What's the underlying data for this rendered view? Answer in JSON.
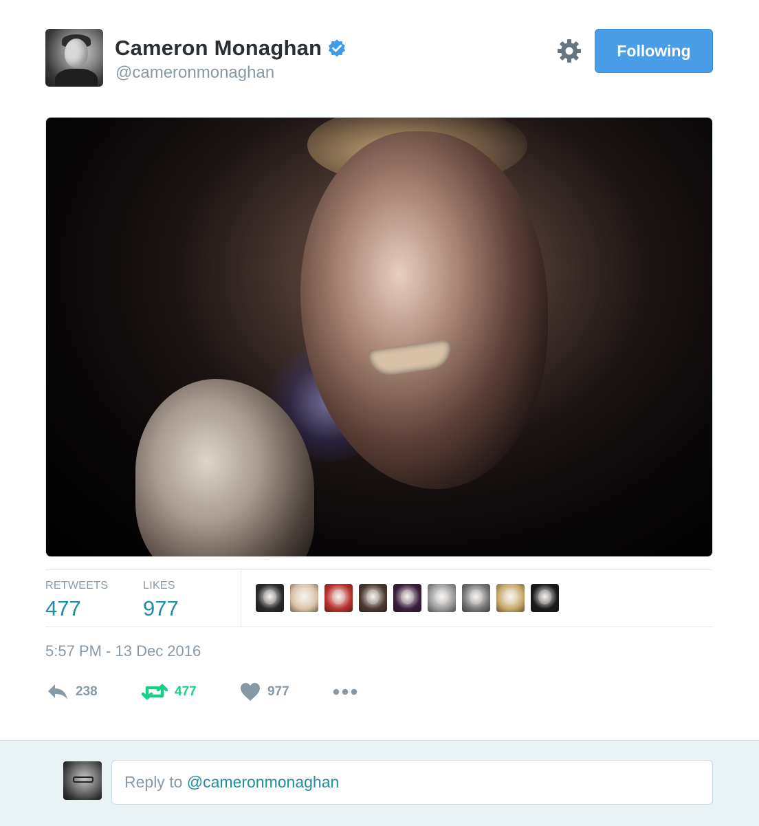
{
  "author": {
    "display_name": "Cameron Monaghan",
    "handle": "@cameronmonaghan",
    "verified": true
  },
  "header": {
    "gear_icon": "gear-icon",
    "follow_button_label": "Following"
  },
  "stats": {
    "retweets_label": "RETWEETS",
    "retweets_count": "477",
    "likes_label": "LIKES",
    "likes_count": "977"
  },
  "likers": [
    {
      "icon": "avatar-acf-logo",
      "bg": "#2a2a2a"
    },
    {
      "icon": "avatar-blonde-woman",
      "bg": "#d9c1a6"
    },
    {
      "icon": "avatar-man-red",
      "bg": "#b8332c"
    },
    {
      "icon": "avatar-dark-man",
      "bg": "#4a3a30"
    },
    {
      "icon": "avatar-joker",
      "bg": "#3a1f3a"
    },
    {
      "icon": "avatar-couple-bw",
      "bg": "#9a9a9a"
    },
    {
      "icon": "avatar-flower-crown",
      "bg": "#777777"
    },
    {
      "icon": "avatar-blonde-hair",
      "bg": "#c9a86a"
    },
    {
      "icon": "avatar-dark-bw",
      "bg": "#1a1a1a"
    }
  ],
  "timestamp": "5:57 PM - 13 Dec 2016",
  "actions": {
    "reply_count": "238",
    "retweet_count": "477",
    "like_count": "977",
    "colors": {
      "reply": "#8899a6",
      "retweet_active": "#19cf86",
      "like": "#8899a6"
    }
  },
  "reply_box": {
    "prefix": "Reply to ",
    "mention": "@cameronmonaghan"
  },
  "colors": {
    "follow_button": "#4a9ee8",
    "stat_value": "#1f8ea0",
    "verified_badge": "#3d9be9",
    "reply_bar_bg": "#e9f3f6"
  }
}
